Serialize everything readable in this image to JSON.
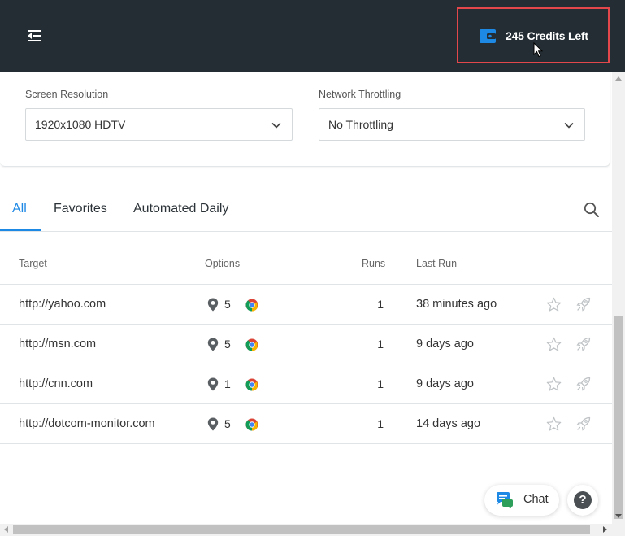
{
  "header": {
    "credits_label": "245 Credits Left",
    "menu_icon": "menu-collapse-icon",
    "wallet_icon": "wallet-icon",
    "accent": "#1e88e5",
    "highlight": "#e3474b"
  },
  "settings": {
    "resolution": {
      "label": "Screen Resolution",
      "value": "1920x1080 HDTV"
    },
    "throttling": {
      "label": "Network Throttling",
      "value": "No Throttling"
    }
  },
  "tabs": [
    {
      "label": "All",
      "active": true
    },
    {
      "label": "Favorites",
      "active": false
    },
    {
      "label": "Automated Daily",
      "active": false
    }
  ],
  "table": {
    "columns": {
      "target": "Target",
      "options": "Options",
      "runs": "Runs",
      "last_run": "Last Run"
    },
    "rows": [
      {
        "target": "http://yahoo.com",
        "locations": "5",
        "browser": "chrome-icon",
        "runs": "1",
        "last_run": "38 minutes ago"
      },
      {
        "target": "http://msn.com",
        "locations": "5",
        "browser": "chrome-icon",
        "runs": "1",
        "last_run": "9 days ago"
      },
      {
        "target": "http://cnn.com",
        "locations": "1",
        "browser": "chrome-icon",
        "runs": "1",
        "last_run": "9 days ago"
      },
      {
        "target": "http://dotcom-monitor.com",
        "locations": "5",
        "browser": "chrome-icon",
        "runs": "1",
        "last_run": "14 days ago"
      }
    ]
  },
  "widgets": {
    "chat_label": "Chat",
    "help_label": "?"
  }
}
